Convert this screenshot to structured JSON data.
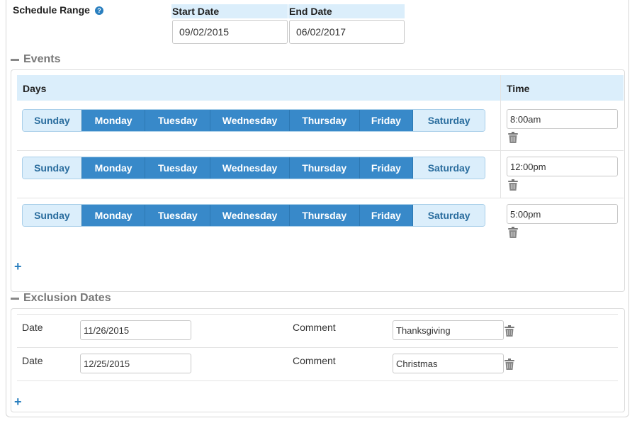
{
  "schedule_range": {
    "label": "Schedule Range",
    "help_icon": "question-circle-icon",
    "start_date_header": "Start Date",
    "start_date_value": "09/02/2015",
    "end_date_header": "End Date",
    "end_date_value": "06/02/2017"
  },
  "events": {
    "section_title": "Events",
    "collapse_icon": "minus-icon",
    "days_header": "Days",
    "time_header": "Time",
    "day_names": [
      "Sunday",
      "Monday",
      "Tuesday",
      "Wednesday",
      "Thursday",
      "Friday",
      "Saturday"
    ],
    "rows": [
      {
        "time": "8:00am",
        "selected_days": [
          "Monday",
          "Tuesday",
          "Wednesday",
          "Thursday",
          "Friday"
        ]
      },
      {
        "time": "12:00pm",
        "selected_days": [
          "Monday",
          "Tuesday",
          "Wednesday",
          "Thursday",
          "Friday"
        ]
      },
      {
        "time": "5:00pm",
        "selected_days": [
          "Monday",
          "Tuesday",
          "Wednesday",
          "Thursday",
          "Friday"
        ]
      }
    ],
    "add_icon": "plus-icon"
  },
  "exclusions": {
    "section_title": "Exclusion Dates",
    "collapse_icon": "minus-icon",
    "date_label": "Date",
    "comment_label": "Comment",
    "rows": [
      {
        "date": "11/26/2015",
        "comment": "Thanksgiving"
      },
      {
        "date": "12/25/2015",
        "comment": "Christmas"
      }
    ],
    "add_icon": "plus-icon"
  },
  "colors": {
    "header_bg": "#dbeefb",
    "day_selected": "#3889c9",
    "day_unselected": "#dbeefb",
    "accent": "#2a7fbf"
  }
}
